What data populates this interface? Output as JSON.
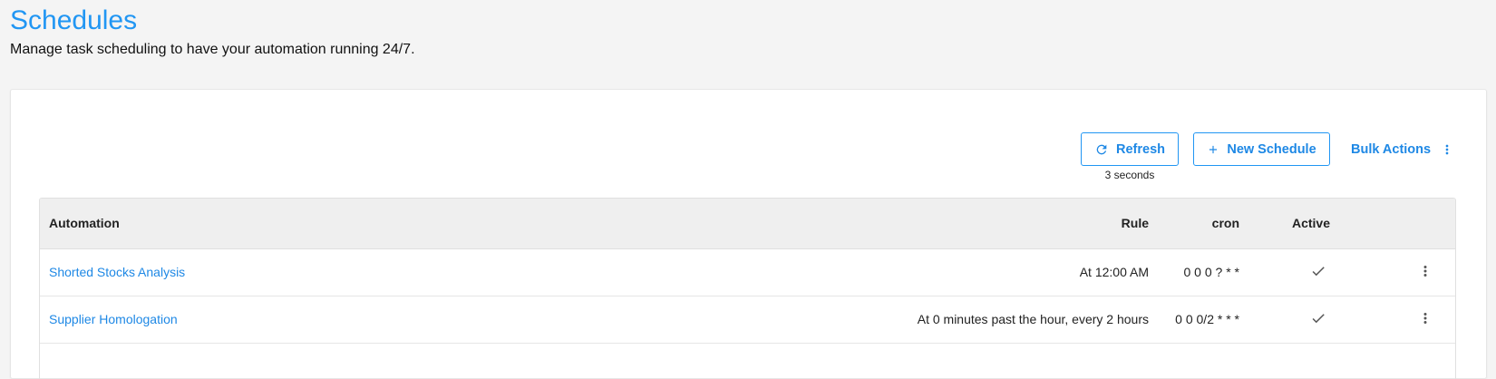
{
  "header": {
    "title": "Schedules",
    "subtitle": "Manage task scheduling to have your automation running 24/7."
  },
  "toolbar": {
    "refresh_label": "Refresh",
    "refresh_interval": "3 seconds",
    "new_label": "New Schedule",
    "bulk_label": "Bulk Actions"
  },
  "table": {
    "columns": [
      "Automation",
      "Rule",
      "cron",
      "Active"
    ],
    "rows": [
      {
        "automation": "Shorted Stocks Analysis",
        "rule": "At 12:00 AM",
        "cron": "0 0 0 ? * *",
        "active": true
      },
      {
        "automation": "Supplier Homologation",
        "rule": "At 0 minutes past the hour, every 2 hours",
        "cron": "0 0 0/2 * * *",
        "active": true
      }
    ]
  },
  "colors": {
    "accent": "#2196f3",
    "header_bg": "#efefef",
    "page_bg": "#f4f4f4"
  },
  "icons": {
    "refresh": "refresh-icon",
    "new": "plus-icon",
    "bulk": "kebab-menu-icon",
    "active": "check-icon",
    "row_menu": "kebab-menu-icon"
  }
}
